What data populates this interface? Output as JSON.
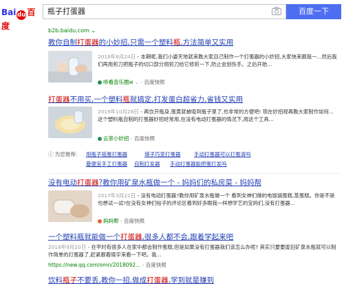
{
  "header": {
    "logo_left": "Bai",
    "logo_paw": "du",
    "logo_right": "百度",
    "query": "瓶子打蛋器",
    "search_button": "百度一下",
    "top_url": "b2b.baidu.com ⌄"
  },
  "results": [
    {
      "title_parts": [
        "教你自制",
        "打蛋器",
        "的小妙招,只需一个塑料",
        "瓶",
        ",方法简单又实用"
      ],
      "date": "2018年8月24日",
      "snippet": " - 本期呢,我们小婆天地就来教大家自己制作一个打蛋器的小妙招,大家快来跟我一...然后我们再用剪刀把瓶子的切口部分用剪刀给它修剪一下,防止会划伤手。之后开始...",
      "source": "哆看音乐圈w",
      "kuaizhao": "百度快照"
    },
    {
      "title_parts": [
        "打蛋器",
        "不用买,一个塑料",
        "瓶",
        "就搞定,打发蛋白超省力,省钱又实用"
      ],
      "date": "2019年10月28日",
      "snippet": " - 再饮开瓶身,蛋黄就被吸到瓶子里了,也非常的方便吧! 现在妙招视再教大家制作如何...这个塑料瓶自制的打蛋器妙招经常用,在没有电动打蛋器的情况下,用这个工具...",
      "source": "云菲小妙招",
      "kuaizhao": "百度快照"
    },
    {
      "title_parts": [
        "没有电动",
        "打蛋器",
        "?教你用矿泉水瓶做一个 - 妈妈们的私房菜 - 妈妈帮"
      ],
      "date": "2017年3月22日",
      "snippet": " - 没有电动打蛋器?教你用矿泉水瓶做一个 看到女神们做的电饭锅蛋糕,蒸蛋糕。你是不是也想试一试?在没有女神们帖子的评论区看到好多眼我一样想学艺的宝妈们,没有打蛋器...",
      "source": "妈妈帮",
      "kuaizhao": "百度快照"
    },
    {
      "title_parts": [
        "一个塑料瓶就能做一个",
        "打蛋器",
        ",很多人都不会,跟着学起来吧"
      ],
      "date": "2018年9月20日",
      "snippet": " - 在平时有很多人在家中都会制作蛋糕,但是如果没有打蛋器我们该怎么办呢? 其实只要要废旧矿泉水瓶就可以制作简单的打蛋器了,赶紧跟着晓宇来看一下吧。我...",
      "url": "https://new.qq.com/omn/2018092...",
      "kuaizhao": "百度快照"
    },
    {
      "title_parts": [
        "饮料",
        "瓶子",
        "不要丢,教你一招,做成",
        "打蛋器",
        ",学到就是赚到"
      ]
    }
  ],
  "recommend": {
    "label": "为您推荐:",
    "items": [
      "用瓶子摇蛋打蛋器",
      "瑛子巧变打蛋器",
      "手动打蛋器可以打蛋清吗",
      "最便宜手工打蛋器",
      "自制打发器",
      "手动打蛋器能把蛋打发吗"
    ]
  },
  "colors": {
    "link": "#2440b3",
    "highlight": "#cc0000",
    "source": "#008000",
    "button": "#4e6ef2"
  }
}
